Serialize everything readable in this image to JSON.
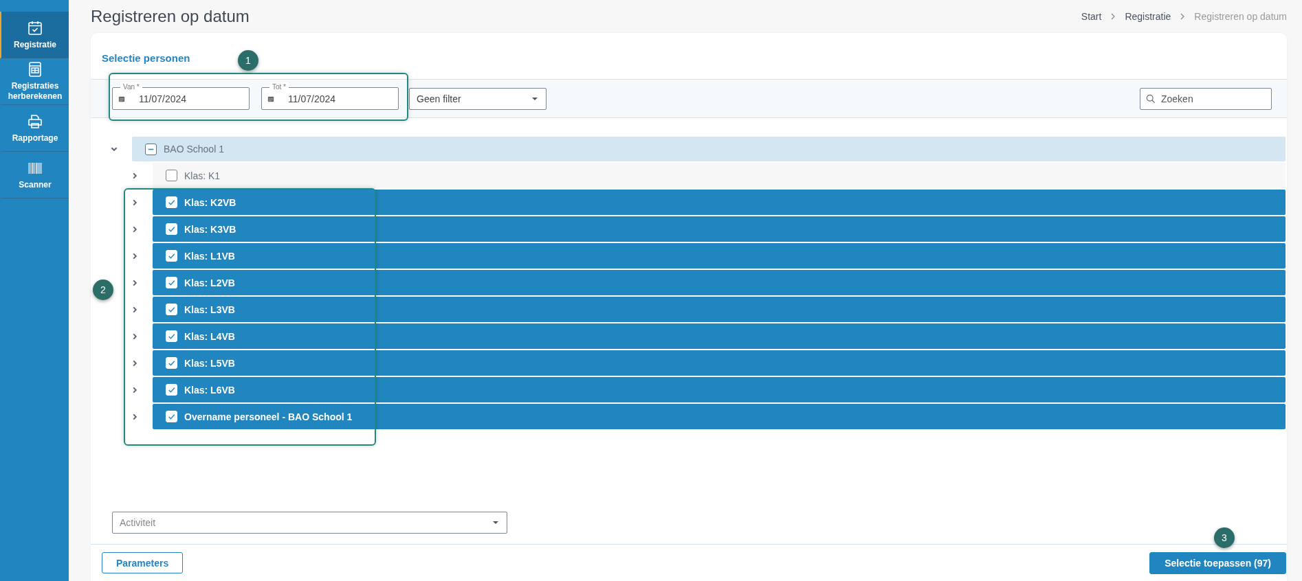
{
  "sidebar": {
    "items": [
      {
        "label": "Registratie",
        "kind": "calendar",
        "selected": true
      },
      {
        "label": "Registraties herberekenen",
        "kind": "calculator",
        "selected": false
      },
      {
        "label": "Rapportage",
        "kind": "printer",
        "selected": false
      },
      {
        "label": "Scanner",
        "kind": "barcode",
        "selected": false
      }
    ]
  },
  "page": {
    "title": "Registreren op datum"
  },
  "breadcrumb": [
    {
      "label": "Start",
      "current": false
    },
    {
      "label": "Registratie",
      "current": false
    },
    {
      "label": "Registreren op datum",
      "current": true
    }
  ],
  "panel": {
    "title": "Selectie personen",
    "date_fields": [
      {
        "label": "Van *",
        "value": "11/07/2024"
      },
      {
        "label": "Tot *",
        "value": "11/07/2024"
      }
    ],
    "filter": {
      "value": "Geen filter"
    },
    "search": {
      "placeholder": "Zoeken"
    },
    "tree": [
      {
        "label": "BAO School 1",
        "expanded": true,
        "checked": false,
        "indeterminate": true,
        "children": [
          {
            "label": "Klas: K1",
            "expanded": false,
            "checked": false
          },
          {
            "label": "Klas: K2VB",
            "expanded": false,
            "checked": true
          },
          {
            "label": "Klas: K3VB",
            "expanded": false,
            "checked": true
          },
          {
            "label": "Klas: L1VB",
            "expanded": false,
            "checked": true
          },
          {
            "label": "Klas: L2VB",
            "expanded": false,
            "checked": true
          },
          {
            "label": "Klas: L3VB",
            "expanded": false,
            "checked": true
          },
          {
            "label": "Klas: L4VB",
            "expanded": false,
            "checked": true
          },
          {
            "label": "Klas: L5VB",
            "expanded": false,
            "checked": true
          },
          {
            "label": "Klas: L6VB",
            "expanded": false,
            "checked": true
          },
          {
            "label": "Overname personeel - BAO School 1",
            "expanded": false,
            "checked": true
          }
        ]
      }
    ],
    "activity": {
      "placeholder": "Activiteit"
    },
    "buttons": [
      {
        "label": "Parameters",
        "kind": "secondary"
      },
      {
        "label": "Selectie toepassen (97)",
        "kind": "primary"
      }
    ]
  },
  "callouts": [
    {
      "number": "1"
    },
    {
      "number": "2"
    },
    {
      "number": "3"
    }
  ]
}
